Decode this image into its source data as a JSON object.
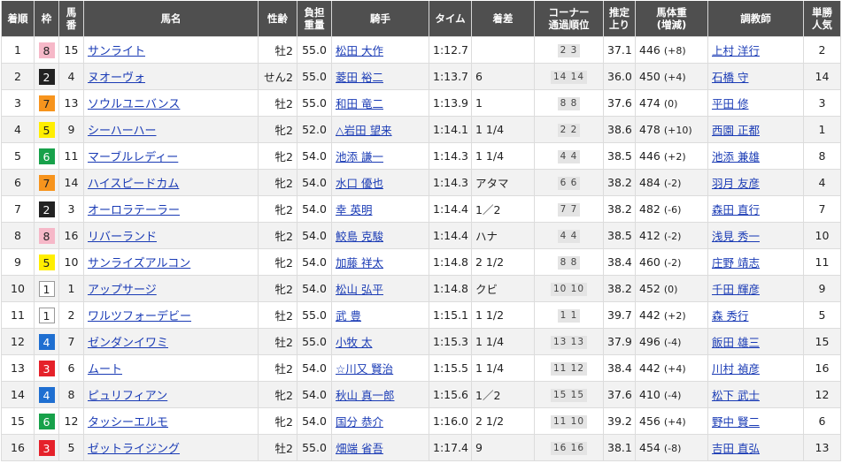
{
  "headers": {
    "rank": "着順",
    "waku": "枠",
    "umaban": "馬番",
    "horse": "馬名",
    "sexage": "性齢",
    "weight": "負担重量",
    "jockey": "騎手",
    "time": "タイム",
    "margin": "着差",
    "corner": "コーナー通過順位",
    "last3f": "推定上り",
    "bodyweight": "馬体重(増減)",
    "trainer": "調教師",
    "odds": "単勝人気"
  },
  "waku_colors": {
    "1": {
      "bg": "#ffffff",
      "fg": "#222222",
      "border": "#999999"
    },
    "2": {
      "bg": "#222222",
      "fg": "#ffffff",
      "border": "#222222"
    },
    "3": {
      "bg": "#e5212a",
      "fg": "#ffffff",
      "border": "#e5212a"
    },
    "4": {
      "bg": "#1f6fd1",
      "fg": "#ffffff",
      "border": "#1f6fd1"
    },
    "5": {
      "bg": "#ffee00",
      "fg": "#222222",
      "border": "#ffee00"
    },
    "6": {
      "bg": "#17a14a",
      "fg": "#ffffff",
      "border": "#17a14a"
    },
    "7": {
      "bg": "#f7941d",
      "fg": "#222222",
      "border": "#f7941d"
    },
    "8": {
      "bg": "#f6b8c8",
      "fg": "#222222",
      "border": "#f6b8c8"
    }
  },
  "rows": [
    {
      "rank": "1",
      "waku": "8",
      "umaban": "15",
      "horse": "サンライト",
      "sexage": "牡2",
      "weight": "55.0",
      "jockey": "松田 大作",
      "time": "1:12.7",
      "margin": "",
      "corner": "2 3",
      "last3f": "37.1",
      "bw": "446",
      "bwc": "(+8)",
      "trainer": "上村 洋行",
      "pop": "2"
    },
    {
      "rank": "2",
      "waku": "2",
      "umaban": "4",
      "horse": "ヌオーヴォ",
      "sexage": "せん2",
      "weight": "55.0",
      "jockey": "菱田 裕二",
      "time": "1:13.7",
      "margin": "6",
      "corner": "14 14",
      "last3f": "36.0",
      "bw": "450",
      "bwc": "(+4)",
      "trainer": "石橋 守",
      "pop": "14"
    },
    {
      "rank": "3",
      "waku": "7",
      "umaban": "13",
      "horse": "ソウルユニバンス",
      "sexage": "牡2",
      "weight": "55.0",
      "jockey": "和田 竜二",
      "time": "1:13.9",
      "margin": "1",
      "corner": "8 8",
      "last3f": "37.6",
      "bw": "474",
      "bwc": "(0)",
      "trainer": "平田 修",
      "pop": "3"
    },
    {
      "rank": "4",
      "waku": "5",
      "umaban": "9",
      "horse": "シーハーハー",
      "sexage": "牝2",
      "weight": "52.0",
      "jockey": "△岩田 望来",
      "time": "1:14.1",
      "margin": "1 1/4",
      "corner": "2 2",
      "last3f": "38.6",
      "bw": "478",
      "bwc": "(+10)",
      "trainer": "西園 正都",
      "pop": "1"
    },
    {
      "rank": "5",
      "waku": "6",
      "umaban": "11",
      "horse": "マーブルレディー",
      "sexage": "牝2",
      "weight": "54.0",
      "jockey": "池添 謙一",
      "time": "1:14.3",
      "margin": "1 1/4",
      "corner": "4 4",
      "last3f": "38.5",
      "bw": "446",
      "bwc": "(+2)",
      "trainer": "池添 兼雄",
      "pop": "8"
    },
    {
      "rank": "6",
      "waku": "7",
      "umaban": "14",
      "horse": "ハイスピードカム",
      "sexage": "牝2",
      "weight": "54.0",
      "jockey": "水口 優也",
      "time": "1:14.3",
      "margin": "アタマ",
      "corner": "6 6",
      "last3f": "38.2",
      "bw": "484",
      "bwc": "(-2)",
      "trainer": "羽月 友彦",
      "pop": "4"
    },
    {
      "rank": "7",
      "waku": "2",
      "umaban": "3",
      "horse": "オーロラテーラー",
      "sexage": "牝2",
      "weight": "54.0",
      "jockey": "幸 英明",
      "time": "1:14.4",
      "margin": "1／2",
      "corner": "7 7",
      "last3f": "38.2",
      "bw": "482",
      "bwc": "(-6)",
      "trainer": "森田 直行",
      "pop": "7"
    },
    {
      "rank": "8",
      "waku": "8",
      "umaban": "16",
      "horse": "リバーランド",
      "sexage": "牝2",
      "weight": "54.0",
      "jockey": "鮫島 克駿",
      "time": "1:14.4",
      "margin": "ハナ",
      "corner": "4 4",
      "last3f": "38.5",
      "bw": "412",
      "bwc": "(-2)",
      "trainer": "浅見 秀一",
      "pop": "10"
    },
    {
      "rank": "9",
      "waku": "5",
      "umaban": "10",
      "horse": "サンライズアルコン",
      "sexage": "牝2",
      "weight": "54.0",
      "jockey": "加藤 祥太",
      "time": "1:14.8",
      "margin": "2 1/2",
      "corner": "8 8",
      "last3f": "38.4",
      "bw": "460",
      "bwc": "(-2)",
      "trainer": "庄野 靖志",
      "pop": "11"
    },
    {
      "rank": "10",
      "waku": "1",
      "umaban": "1",
      "horse": "アップサージ",
      "sexage": "牝2",
      "weight": "54.0",
      "jockey": "松山 弘平",
      "time": "1:14.8",
      "margin": "クビ",
      "corner": "10 10",
      "last3f": "38.2",
      "bw": "452",
      "bwc": "(0)",
      "trainer": "千田 輝彦",
      "pop": "9"
    },
    {
      "rank": "11",
      "waku": "1",
      "umaban": "2",
      "horse": "ワルツフォーデビー",
      "sexage": "牡2",
      "weight": "55.0",
      "jockey": "武 豊",
      "time": "1:15.1",
      "margin": "1 1/2",
      "corner": "1 1",
      "last3f": "39.7",
      "bw": "442",
      "bwc": "(+2)",
      "trainer": "森 秀行",
      "pop": "5"
    },
    {
      "rank": "12",
      "waku": "4",
      "umaban": "7",
      "horse": "ゼンダンイワミ",
      "sexage": "牡2",
      "weight": "55.0",
      "jockey": "小牧 太",
      "time": "1:15.3",
      "margin": "1 1/4",
      "corner": "13 13",
      "last3f": "37.9",
      "bw": "496",
      "bwc": "(-4)",
      "trainer": "飯田 雄三",
      "pop": "15"
    },
    {
      "rank": "13",
      "waku": "3",
      "umaban": "6",
      "horse": "ムート",
      "sexage": "牡2",
      "weight": "54.0",
      "jockey": "☆川又 賢治",
      "time": "1:15.5",
      "margin": "1 1/4",
      "corner": "11 12",
      "last3f": "38.4",
      "bw": "442",
      "bwc": "(+4)",
      "trainer": "川村 禎彦",
      "pop": "16"
    },
    {
      "rank": "14",
      "waku": "4",
      "umaban": "8",
      "horse": "ピュリフィアン",
      "sexage": "牝2",
      "weight": "54.0",
      "jockey": "秋山 真一郎",
      "time": "1:15.6",
      "margin": "1／2",
      "corner": "15 15",
      "last3f": "37.6",
      "bw": "410",
      "bwc": "(-4)",
      "trainer": "松下 武士",
      "pop": "12"
    },
    {
      "rank": "15",
      "waku": "6",
      "umaban": "12",
      "horse": "タッシーエルモ",
      "sexage": "牝2",
      "weight": "54.0",
      "jockey": "国分 恭介",
      "time": "1:16.0",
      "margin": "2 1/2",
      "corner": "11 10",
      "last3f": "39.2",
      "bw": "456",
      "bwc": "(+4)",
      "trainer": "野中 賢二",
      "pop": "6"
    },
    {
      "rank": "16",
      "waku": "3",
      "umaban": "5",
      "horse": "ゼットライジング",
      "sexage": "牡2",
      "weight": "55.0",
      "jockey": "畑端 省吾",
      "time": "1:17.4",
      "margin": "9",
      "corner": "16 16",
      "last3f": "38.1",
      "bw": "454",
      "bwc": "(-8)",
      "trainer": "吉田 直弘",
      "pop": "13"
    }
  ]
}
